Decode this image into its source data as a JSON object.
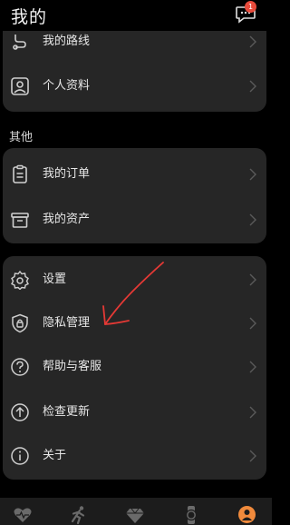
{
  "header": {
    "title": "我的",
    "badge_count": "1"
  },
  "card1": {
    "items": [
      {
        "label": "我的路线"
      },
      {
        "label": "个人资料"
      }
    ]
  },
  "section": {
    "title": "其他"
  },
  "card2": {
    "items": [
      {
        "label": "我的订单"
      },
      {
        "label": "我的资产"
      }
    ]
  },
  "card3": {
    "items": [
      {
        "label": "设置"
      },
      {
        "label": "隐私管理"
      },
      {
        "label": "帮助与客服"
      },
      {
        "label": "检查更新"
      },
      {
        "label": "关于"
      }
    ]
  },
  "bottom_nav": {
    "items": [
      "heart-icon",
      "run-icon",
      "diamond-icon",
      "watch-icon",
      "person-icon"
    ],
    "active": "person-icon"
  },
  "colors": {
    "accent": "#f08a3c",
    "badge": "#e84a3b",
    "card": "#262626",
    "annotation": "#e53935"
  }
}
